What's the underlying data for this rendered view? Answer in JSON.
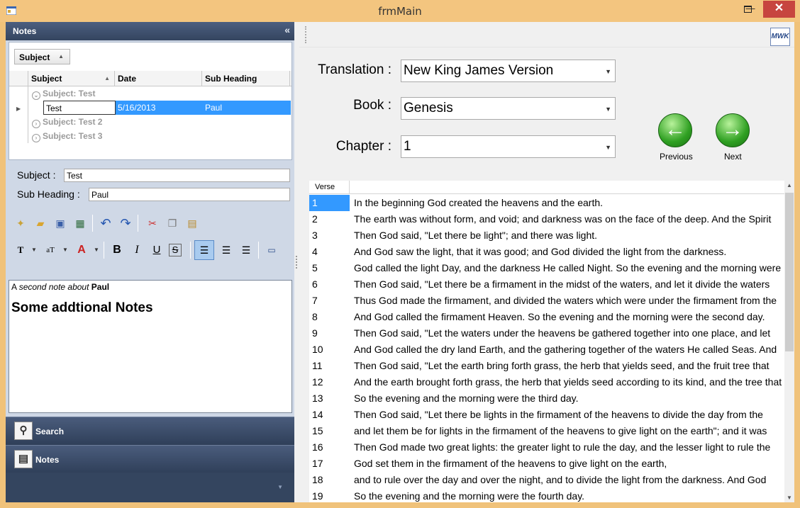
{
  "window": {
    "title": "frmMain",
    "minimize": "—",
    "close": "✕"
  },
  "notes": {
    "header": "Notes",
    "group_chip": "Subject",
    "columns": [
      "Subject",
      "Date",
      "Sub Heading"
    ],
    "groups": [
      "Subject: Test",
      "Subject: Test 2",
      "Subject: Test 3"
    ],
    "row": {
      "subject": "Test",
      "date": "5/16/2013",
      "sub_heading": "Paul"
    },
    "subject_label": "Subject :",
    "subject_value": "Test",
    "subheading_label": "Sub Heading :",
    "subheading_value": "Paul",
    "editor": {
      "line1_a": "A ",
      "line1_b": "second note about",
      "line1_c": " Paul",
      "line2": "Some addtional Notes"
    }
  },
  "nav": {
    "search": "Search",
    "notes": "Notes"
  },
  "reader": {
    "translation_label": "Translation :",
    "translation_value": "New King James Version",
    "book_label": "Book :",
    "book_value": "Genesis",
    "chapter_label": "Chapter :",
    "chapter_value": "1",
    "previous": "Previous",
    "next": "Next",
    "verse_header": "Verse",
    "verses": [
      {
        "n": "1",
        "t": "In the beginning God created the heavens and the earth."
      },
      {
        "n": "2",
        "t": "The earth was without form, and void; and darkness was on the face of the deep. And the Spirit"
      },
      {
        "n": "3",
        "t": "Then God said, \"Let there be light\"; and there was light."
      },
      {
        "n": "4",
        "t": "And God saw the light, that it was good; and God divided the light from the darkness."
      },
      {
        "n": "5",
        "t": "God called the light Day, and the darkness He called Night. So the evening and the morning were"
      },
      {
        "n": "6",
        "t": "Then God said, \"Let there be a firmament in the midst of the waters, and let it divide the waters"
      },
      {
        "n": "7",
        "t": "Thus God made the firmament, and divided the waters which were under the firmament from the"
      },
      {
        "n": "8",
        "t": "And God called the firmament Heaven. So the evening and the morning were the second day."
      },
      {
        "n": "9",
        "t": "Then God said, \"Let the waters under the heavens be gathered together into one place, and let"
      },
      {
        "n": "10",
        "t": "And God called the dry land Earth, and the gathering together of the waters He called Seas. And"
      },
      {
        "n": "11",
        "t": "Then God said, \"Let the earth bring forth grass, the herb that yields seed, and the fruit tree that"
      },
      {
        "n": "12",
        "t": "And the earth brought forth grass, the herb that yields seed according to its kind, and the tree that"
      },
      {
        "n": "13",
        "t": "So the evening and the morning were the third day."
      },
      {
        "n": "14",
        "t": "Then God said, \"Let there be lights in the firmament of the heavens to divide the day from the"
      },
      {
        "n": "15",
        "t": "and let them be for lights in the firmament of the heavens to give light on the earth\"; and it was"
      },
      {
        "n": "16",
        "t": "Then God made two great lights: the greater light to rule the day, and the lesser light to rule the"
      },
      {
        "n": "17",
        "t": "God set them in the firmament of the heavens to give light on the earth,"
      },
      {
        "n": "18",
        "t": "and to rule over the day and over the night, and to divide the light from the darkness. And God"
      },
      {
        "n": "19",
        "t": "So the evening and the morning were the fourth day."
      }
    ]
  }
}
